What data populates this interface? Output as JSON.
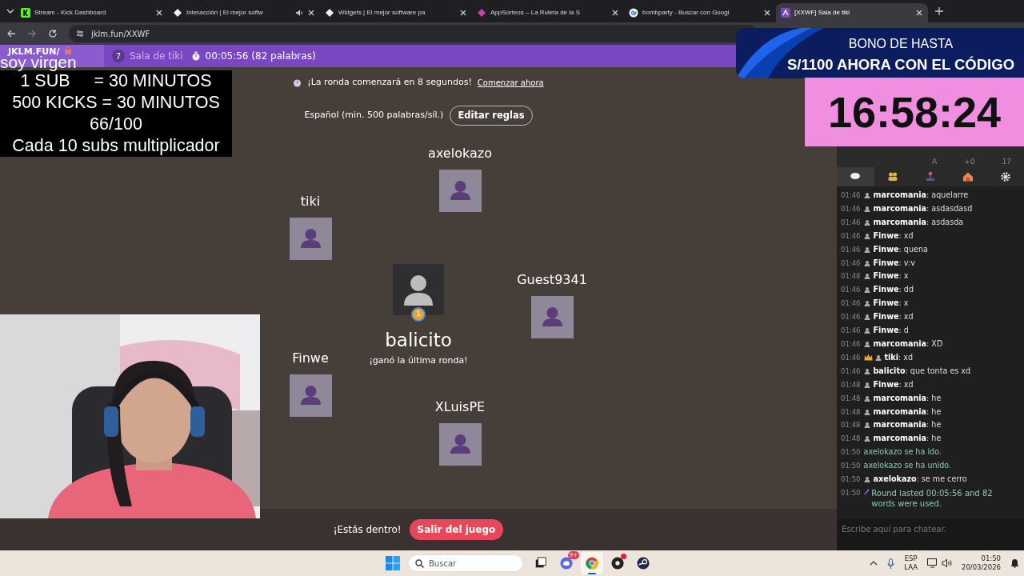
{
  "browser": {
    "tabs": [
      {
        "title": "Stream - Kick Dashboard",
        "selected": false,
        "audio": false
      },
      {
        "title": "Interacción | El mejor softw",
        "selected": false,
        "audio": true
      },
      {
        "title": "Widgets | El mejor software pa",
        "selected": false,
        "audio": false
      },
      {
        "title": "AppSorteos – La Ruleta de la S",
        "selected": false,
        "audio": false
      },
      {
        "title": "bombparty - Buscar con Googl",
        "selected": false,
        "audio": false
      },
      {
        "title": "[XXWF] Sala de tiki",
        "selected": true,
        "audio": false
      }
    ],
    "address": "jklm.fun/XXWF"
  },
  "game_header": {
    "site": "JKLM.FUN/",
    "room_count": "7",
    "room_name": "Sala de tiki",
    "elapsed": "00:05:56 (82 palabras)"
  },
  "notice": {
    "text": "¡La ronda comenzará en 8 segundos!",
    "link": "Comenzar ahora"
  },
  "rules": {
    "text": "Español (min. 500 palabras/síl.)",
    "button": "Editar reglas"
  },
  "players": [
    {
      "name": "axelokazo",
      "kind": "player"
    },
    {
      "name": "tiki",
      "kind": "player"
    },
    {
      "name": "Guest9341",
      "kind": "player"
    },
    {
      "name": "Finwe",
      "kind": "player"
    },
    {
      "name": "balicito",
      "kind": "winner",
      "subtitle": "¡ganó la última ronda!",
      "medal": "1"
    },
    {
      "name": "XLuisPE",
      "kind": "player"
    }
  ],
  "join_bar": {
    "text": "¡Estás dentro!",
    "button": "Salir del juego"
  },
  "side_panel": {
    "stats_cells": [
      "A",
      "+0",
      "17"
    ],
    "tabs": [
      {
        "selected": true
      },
      {
        "selected": false
      },
      {
        "selected": false
      },
      {
        "selected": false
      },
      {
        "selected": false
      }
    ],
    "messages": [
      {
        "time": "01:46",
        "kind": "user",
        "crown": false,
        "text": "**marcomania**: aquelarre"
      },
      {
        "time": "01:46",
        "kind": "user",
        "crown": false,
        "text": "**marcomania**: asdasdasd"
      },
      {
        "time": "01:46",
        "kind": "user",
        "crown": false,
        "text": "**marcomania**: asdasda"
      },
      {
        "time": "01:46",
        "kind": "user",
        "crown": false,
        "text": "**Finwe**: xd"
      },
      {
        "time": "01:46",
        "kind": "user",
        "crown": false,
        "text": "**Finwe**: quena"
      },
      {
        "time": "01:46",
        "kind": "user",
        "crown": false,
        "text": "**Finwe**: v:v"
      },
      {
        "time": "01:48",
        "kind": "user",
        "crown": false,
        "text": "**Finwe**: x"
      },
      {
        "time": "01:46",
        "kind": "user",
        "crown": false,
        "text": "**Finwe**: dd"
      },
      {
        "time": "01:46",
        "kind": "user",
        "crown": false,
        "text": "**Finwe**: x"
      },
      {
        "time": "01:46",
        "kind": "user",
        "crown": false,
        "text": "**Finwe**: xd"
      },
      {
        "time": "01:46",
        "kind": "user",
        "crown": false,
        "text": "**Finwe**: d"
      },
      {
        "time": "01:46",
        "kind": "user",
        "crown": false,
        "text": "**marcomania**: XD"
      },
      {
        "time": "01:46",
        "kind": "user",
        "crown": true,
        "text": "**tiki**: xd"
      },
      {
        "time": "01:46",
        "kind": "user",
        "crown": false,
        "text": "**balicito**: que tonta es xd"
      },
      {
        "time": "01:48",
        "kind": "user",
        "crown": false,
        "text": "**Finwe**: xd"
      },
      {
        "time": "01:48",
        "kind": "user",
        "crown": false,
        "text": "**marcomania**: he"
      },
      {
        "time": "01:48",
        "kind": "user",
        "crown": false,
        "text": "**marcomania**: he"
      },
      {
        "time": "01:48",
        "kind": "user",
        "crown": false,
        "text": "**marcomania**: he"
      },
      {
        "time": "01:48",
        "kind": "user",
        "crown": false,
        "text": "**marcomania**: he"
      },
      {
        "time": "01:50",
        "kind": "system",
        "text": "axelokazo se ha ido."
      },
      {
        "time": "01:50",
        "kind": "system",
        "text": "axelokazo se ha unido."
      },
      {
        "time": "01:50",
        "kind": "user",
        "crown": false,
        "text": "**axelokazo**: se me cerro"
      },
      {
        "time": "01:50",
        "kind": "event",
        "text": "Round lasted 00:05:56 and 82 words were used."
      }
    ],
    "chat_input": {
      "placeholder": "Escribe aquí para chatear."
    }
  },
  "overlay_text": [
    "soy virgen",
    "1 SUB     = 30 MINUTOS",
    "500 KICKS = 30 MINUTOS",
    "66/100",
    "Cada 10 subs multiplicador"
  ],
  "ad_banner": [
    "BONO DE HASTA",
    "S/1100 AHORA CON EL CÓDIGO"
  ],
  "countdown": "16:58:24",
  "webcam": {
    "kind": "picture"
  },
  "taskbar": {
    "search_placeholder": "Buscar",
    "apps": [
      {
        "selected": false
      },
      {
        "selected": false,
        "badge": "9+"
      },
      {
        "selected": true
      },
      {
        "selected": false,
        "notification": true
      },
      {
        "selected": false
      }
    ],
    "language": [
      "ESP",
      "LAA"
    ],
    "time": "01:50",
    "date": "20/03/2026"
  }
}
